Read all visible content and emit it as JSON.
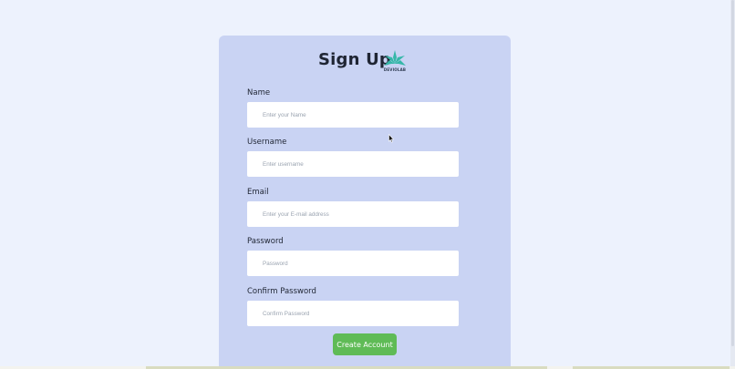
{
  "form": {
    "title": "Sign Up",
    "logo_text": "DEVIOLAB",
    "fields": [
      {
        "label": "Name",
        "placeholder": "Enter your Name"
      },
      {
        "label": "Username",
        "placeholder": "Enter username"
      },
      {
        "label": "Email",
        "placeholder": "Enter your E-mail address"
      },
      {
        "label": "Password",
        "placeholder": "Password"
      },
      {
        "label": "Confirm Password",
        "placeholder": "Confirm Password"
      }
    ],
    "submit_label": "Create Account"
  },
  "colors": {
    "page_background": "#edf2fd",
    "card_background": "#c9d3f3",
    "button_background": "#5fbb56",
    "logo_accent": "#35b7a8"
  }
}
